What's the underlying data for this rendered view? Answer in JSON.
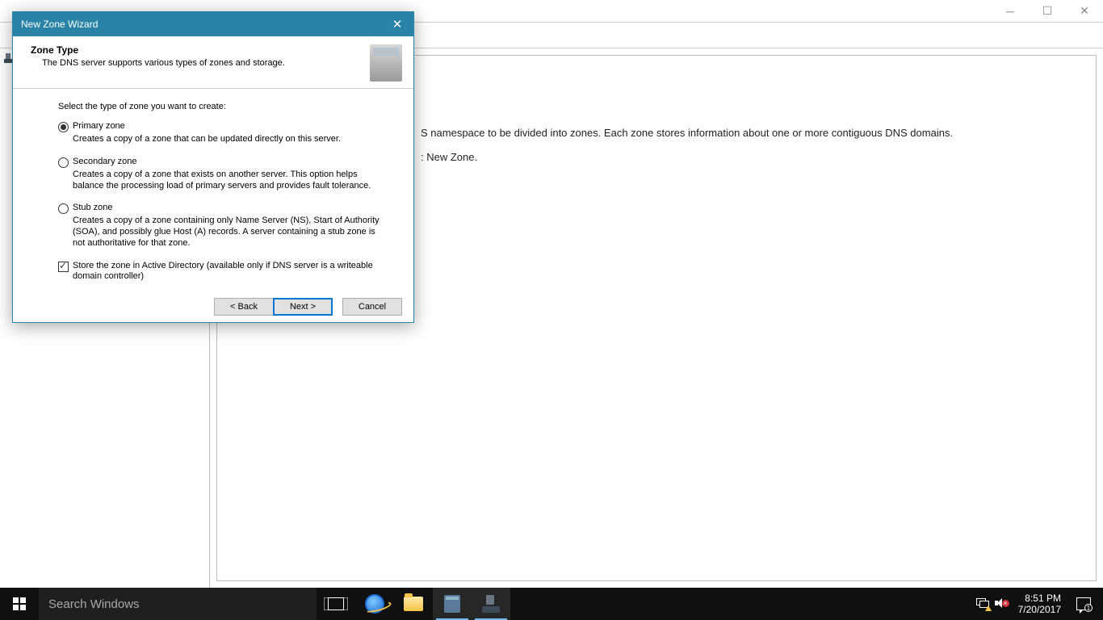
{
  "parent": {
    "bg_text_1": "namespace to be divided into zones. Each zone stores information about one or more contiguous DNS domains.",
    "bg_text_1_prefix": "S",
    "bg_text_2": "New Zone.",
    "bg_text_2_prefix": ":"
  },
  "wizard": {
    "title": "New Zone Wizard",
    "header_title": "Zone Type",
    "header_sub": "The DNS server supports various types of zones and storage.",
    "prompt": "Select the type of zone you want to create:",
    "options": [
      {
        "label": "Primary zone",
        "desc": "Creates a copy of a zone that can be updated directly on this server.",
        "checked": true
      },
      {
        "label": "Secondary zone",
        "desc": "Creates a copy of a zone that exists on another server. This option helps balance the processing load of primary servers and provides fault tolerance.",
        "checked": false
      },
      {
        "label": "Stub zone",
        "desc": "Creates a copy of a zone containing only Name Server (NS), Start of Authority (SOA), and possibly glue Host (A) records. A server containing a stub zone is not authoritative for that zone.",
        "checked": false
      }
    ],
    "checkbox_label": "Store the zone in Active Directory (available only if DNS server is a writeable domain controller)",
    "checkbox_checked": true,
    "buttons": {
      "back": "< Back",
      "next": "Next >",
      "cancel": "Cancel"
    }
  },
  "taskbar": {
    "search_placeholder": "Search Windows",
    "time": "8:51 PM",
    "date": "7/20/2017",
    "notif_count": "1"
  }
}
